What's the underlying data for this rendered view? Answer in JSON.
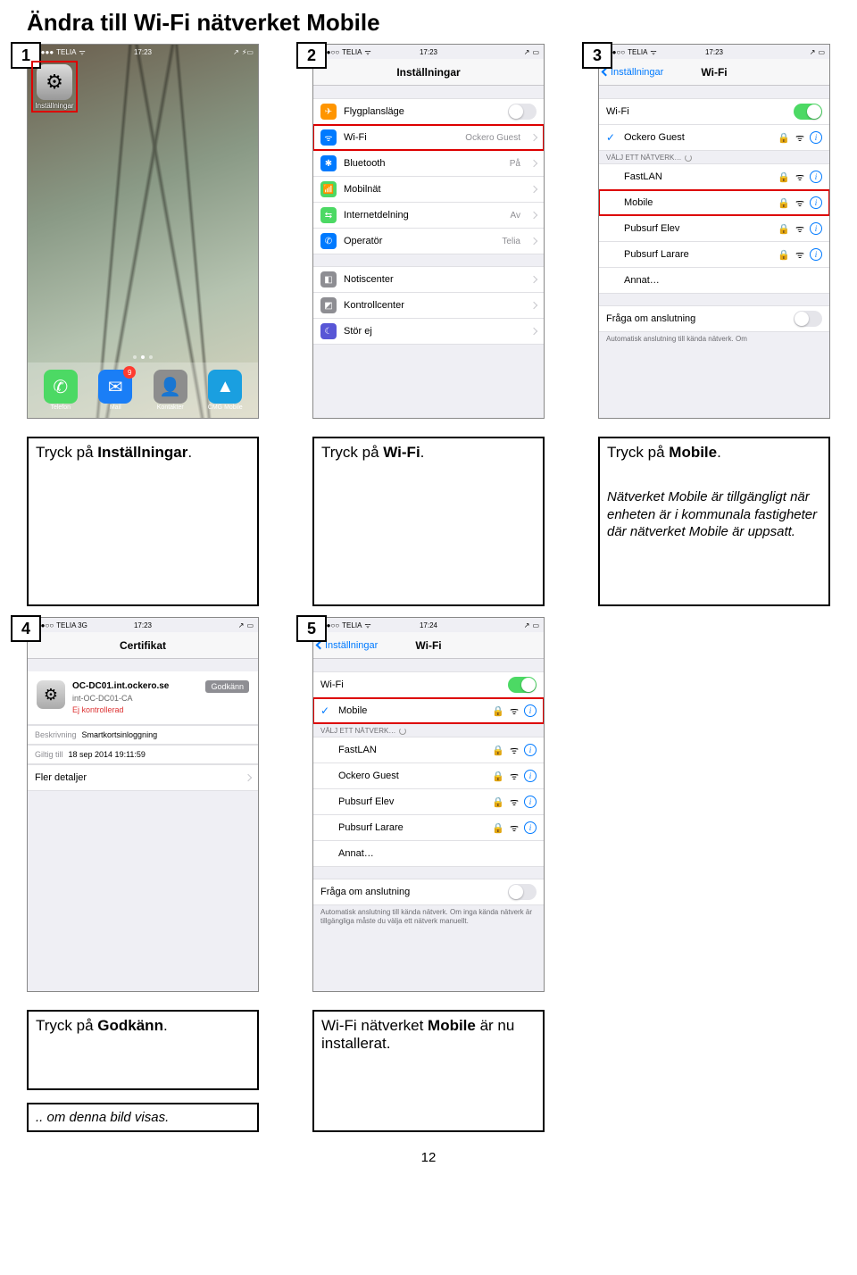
{
  "page_title": "Ändra till Wi-Fi nätverket Mobile",
  "page_number": "12",
  "steps": [
    "1",
    "2",
    "3",
    "4",
    "5"
  ],
  "captions": {
    "c1": "Tryck på Inställningar.",
    "c2": "Tryck på Wi-Fi.",
    "c3_main": "Tryck på Mobile.",
    "c3_note": "Nätverket Mobile är tillgängligt när enheten är i kommunala fastigheter där nätverket Mobile är uppsatt.",
    "c4_main": "Tryck på Godkänn.",
    "c4_note": ".. om denna bild visas.",
    "c5": "Wi-Fi nätverket Mobile är nu installerat."
  },
  "statusbar": {
    "carrier": "TELIA",
    "carrier3g": "TELIA 3G",
    "time": "17:23",
    "time2": "17:24"
  },
  "screen1": {
    "settings_label": "Inställningar",
    "dock": [
      {
        "label": "Telefon",
        "color": "#4cd964"
      },
      {
        "label": "Mail",
        "color": "#1a7ef6",
        "badge": "9"
      },
      {
        "label": "Kontakter",
        "color": "#8d8d8d"
      },
      {
        "label": "CMG Mobile",
        "color": "#1a9fe0"
      }
    ]
  },
  "screen2": {
    "title": "Inställningar",
    "rows": [
      {
        "icon": "#ff9500",
        "glyph": "✈",
        "label": "Flygplansläge",
        "toggle": true,
        "on": false
      },
      {
        "icon": "#007aff",
        "glyph": "ᯤ",
        "label": "Wi-Fi",
        "value": "Ockero Guest",
        "chev": true,
        "hl": true
      },
      {
        "icon": "#007aff",
        "glyph": "✱",
        "label": "Bluetooth",
        "value": "På",
        "chev": true
      },
      {
        "icon": "#4cd964",
        "glyph": "📶",
        "label": "Mobilnät",
        "chev": true
      },
      {
        "icon": "#4cd964",
        "glyph": "⇆",
        "label": "Internetdelning",
        "value": "Av",
        "chev": true
      },
      {
        "icon": "#007aff",
        "glyph": "✆",
        "label": "Operatör",
        "value": "Telia",
        "chev": true
      }
    ],
    "rows2": [
      {
        "icon": "#8e8e93",
        "glyph": "◧",
        "label": "Notiscenter",
        "chev": true
      },
      {
        "icon": "#8e8e93",
        "glyph": "◩",
        "label": "Kontrollcenter",
        "chev": true
      },
      {
        "icon": "#5856d6",
        "glyph": "☾",
        "label": "Stör ej",
        "chev": true
      }
    ]
  },
  "screen3": {
    "back": "Inställningar",
    "title": "Wi-Fi",
    "wifi_row": "Wi-Fi",
    "connected": "Ockero Guest",
    "choose_header": "VÄLJ ETT NÄTVERK…",
    "networks": [
      {
        "name": "FastLAN",
        "lock": true
      },
      {
        "name": "Mobile",
        "lock": true,
        "hl": true
      },
      {
        "name": "Pubsurf Elev",
        "lock": true
      },
      {
        "name": "Pubsurf Larare",
        "lock": true
      },
      {
        "name": "Annat…"
      }
    ],
    "ask": "Fråga om anslutning",
    "footer": "Automatisk anslutning till kända nätverk. Om"
  },
  "screen4": {
    "title": "Certifikat",
    "cert_name": "OC-DC01.int.ockero.se",
    "cert_issuer": "int-OC-DC01-CA",
    "cert_status": "Ej kontrollerad",
    "approve": "Godkänn",
    "desc_label": "Beskrivning",
    "desc_value": "Smartkortsinloggning",
    "valid_label": "Giltig till",
    "valid_value": "18 sep 2014 19:11:59",
    "more": "Fler detaljer"
  },
  "screen5": {
    "back": "Inställningar",
    "title": "Wi-Fi",
    "wifi_row": "Wi-Fi",
    "connected": "Mobile",
    "choose_header": "VÄLJ ETT NÄTVERK…",
    "networks": [
      {
        "name": "FastLAN",
        "lock": true
      },
      {
        "name": "Ockero Guest",
        "lock": true
      },
      {
        "name": "Pubsurf Elev",
        "lock": true
      },
      {
        "name": "Pubsurf Larare",
        "lock": true
      },
      {
        "name": "Annat…"
      }
    ],
    "ask": "Fråga om anslutning",
    "footer": "Automatisk anslutning till kända nätverk. Om inga kända nätverk är tillgängliga måste du välja ett nätverk manuellt."
  }
}
